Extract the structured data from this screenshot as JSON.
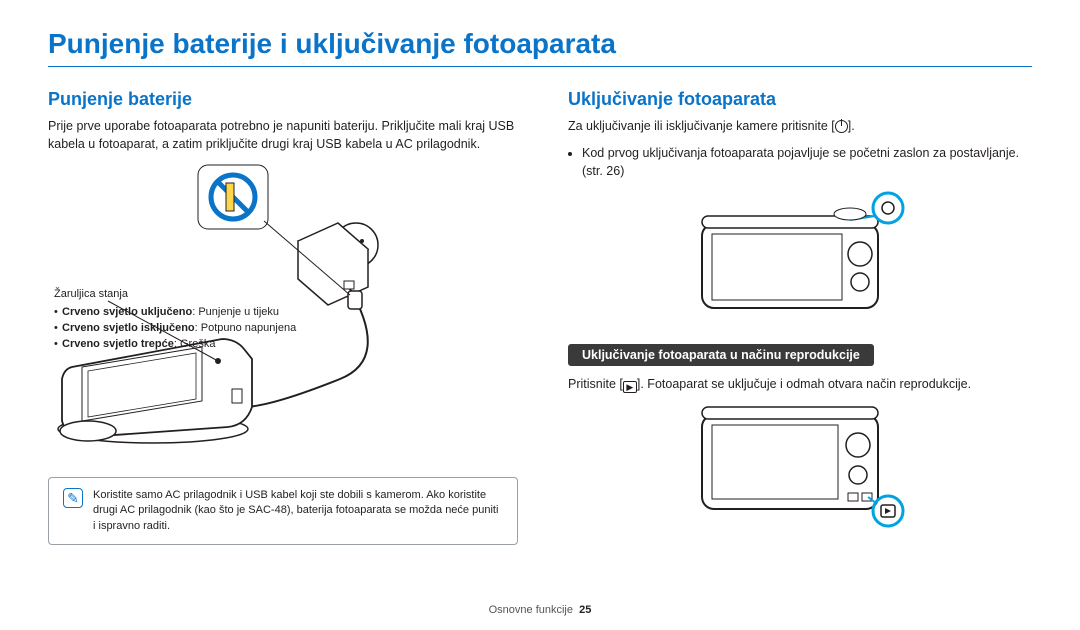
{
  "pageTitle": "Punjenje baterije i uključivanje fotoaparata",
  "left": {
    "heading": "Punjenje baterije",
    "paragraph": "Prije prve uporabe fotoaparata potrebno je napuniti bateriju. Priključite mali kraj USB kabela u fotoaparat, a zatim priključite drugi kraj USB kabela u AC prilagodnik.",
    "ledLabelTitle": "Žaruljica stanja",
    "ledItems": {
      "a_label": "Crveno svjetlo uključeno",
      "a_desc": ": Punjenje u tijeku",
      "b_label": "Crveno svjetlo isključeno",
      "b_desc": ": Potpuno napunjena",
      "c_label": "Crveno svjetlo trepće",
      "c_desc": ": Greška"
    },
    "noteText": "Koristite samo AC prilagodnik i USB kabel koji ste dobili s kamerom. Ako koristite drugi AC prilagodnik (kao što je SAC-48), baterija fotoaparata se možda neće puniti i ispravno raditi."
  },
  "right": {
    "heading": "Uključivanje fotoaparata",
    "paragraphA": "Za uključivanje ili isključivanje kamere pritisnite [",
    "paragraphB": "].",
    "bullet": "Kod prvog uključivanja fotoaparata pojavljuje se početni zaslon za postavljanje. (str. 26)",
    "subheading": "Uključivanje fotoaparata u načinu reprodukcije",
    "playbackA": "Pritisnite [",
    "playbackB": "]. Fotoaparat se uključuje i odmah otvara način reprodukcije."
  },
  "footer": {
    "section": "Osnovne funkcije",
    "page": "25"
  },
  "icons": {
    "play": "▶",
    "note": "✎"
  }
}
